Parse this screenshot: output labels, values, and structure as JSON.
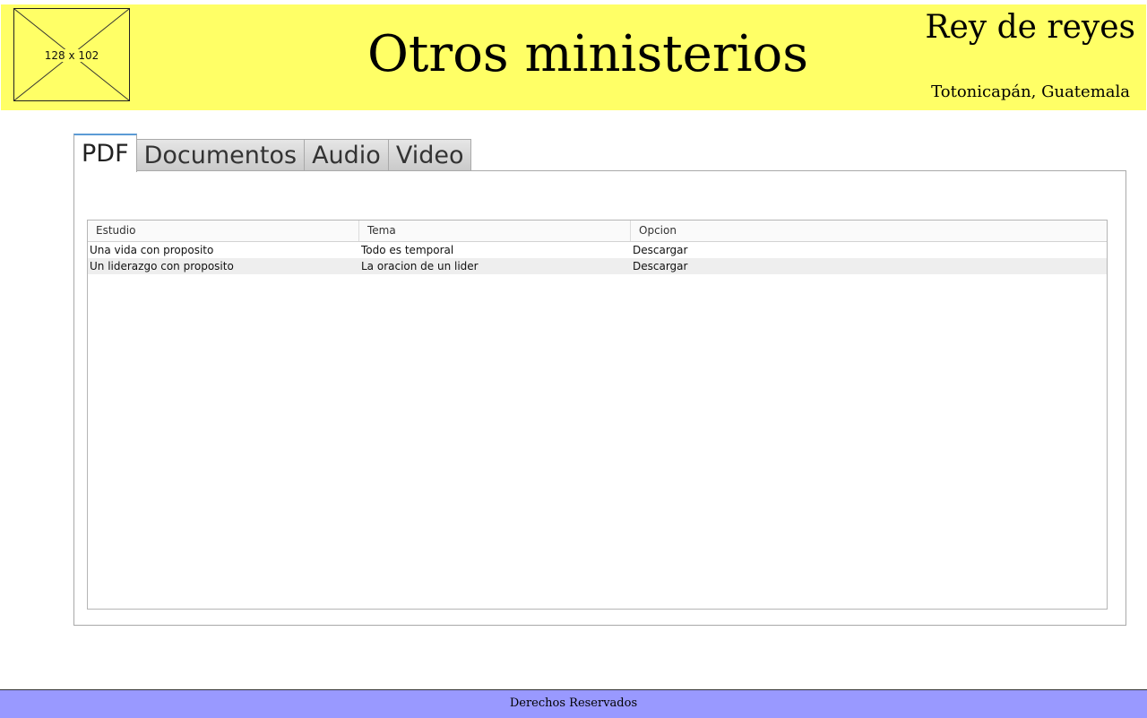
{
  "header": {
    "logo_placeholder": "128 x 102",
    "title": "Otros ministerios",
    "church_name": "Rey de reyes",
    "location": "Totonicapán, Guatemala",
    "background_color": "#ffff66"
  },
  "tabs": [
    {
      "label": "PDF",
      "active": true
    },
    {
      "label": "Documentos",
      "active": false
    },
    {
      "label": "Audio",
      "active": false
    },
    {
      "label": "Video",
      "active": false
    }
  ],
  "grid": {
    "columns": [
      "Estudio",
      "Tema",
      "Opcion"
    ],
    "rows": [
      [
        "Una vida con proposito",
        "Todo es temporal",
        "Descargar"
      ],
      [
        "Un liderazgo con proposito",
        "La oracion de un lider",
        "Descargar"
      ]
    ]
  },
  "footer": {
    "text": "Derechos Reservados",
    "background_color": "#9999ff"
  }
}
